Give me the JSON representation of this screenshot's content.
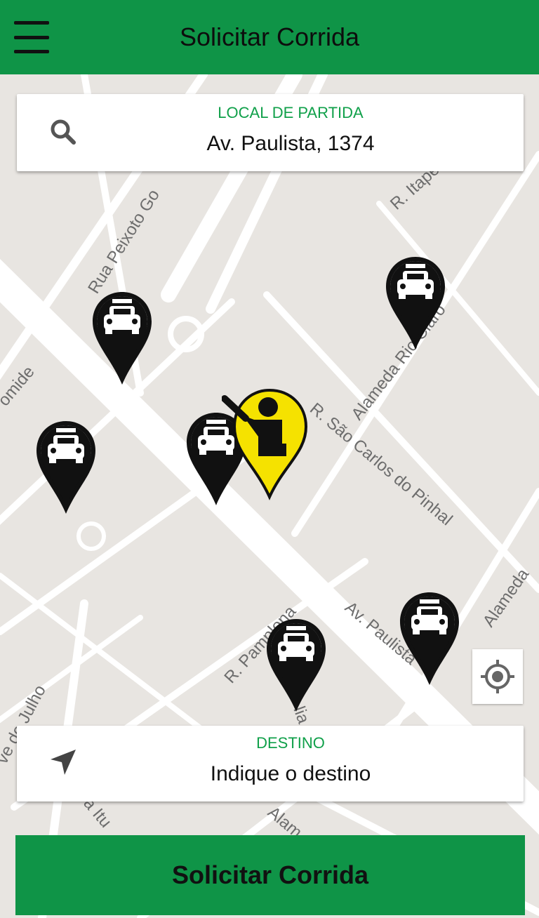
{
  "header": {
    "title": "Solicitar Corrida",
    "menu_icon": "hamburger-menu-icon"
  },
  "origin": {
    "label": "LOCAL DE PARTIDA",
    "value": "Av. Paulista, 1374",
    "icon": "search-icon"
  },
  "destination": {
    "label": "DESTINO",
    "placeholder": "Indique o destino",
    "icon": "navigation-arrow-icon"
  },
  "map": {
    "streets": [
      "Rua Peixoto Go",
      "R. Itape",
      "Alameda Rio Claro",
      "R. São Carlos do Pinhal",
      "Av. Paulista",
      "R. Pamplona",
      "Alameda",
      "omide",
      "ve de Julho",
      "a Itu",
      "Alam",
      "lia"
    ],
    "user_pin_icon": "person-hailing-icon",
    "taxi_pin_icon": "taxi-icon",
    "locate_icon": "my-location-icon"
  },
  "cta": {
    "label": "Solicitar Corrida"
  },
  "colors": {
    "brand_green": "#0f9447",
    "label_green": "#10a04a",
    "user_pin_yellow": "#f5e200"
  }
}
